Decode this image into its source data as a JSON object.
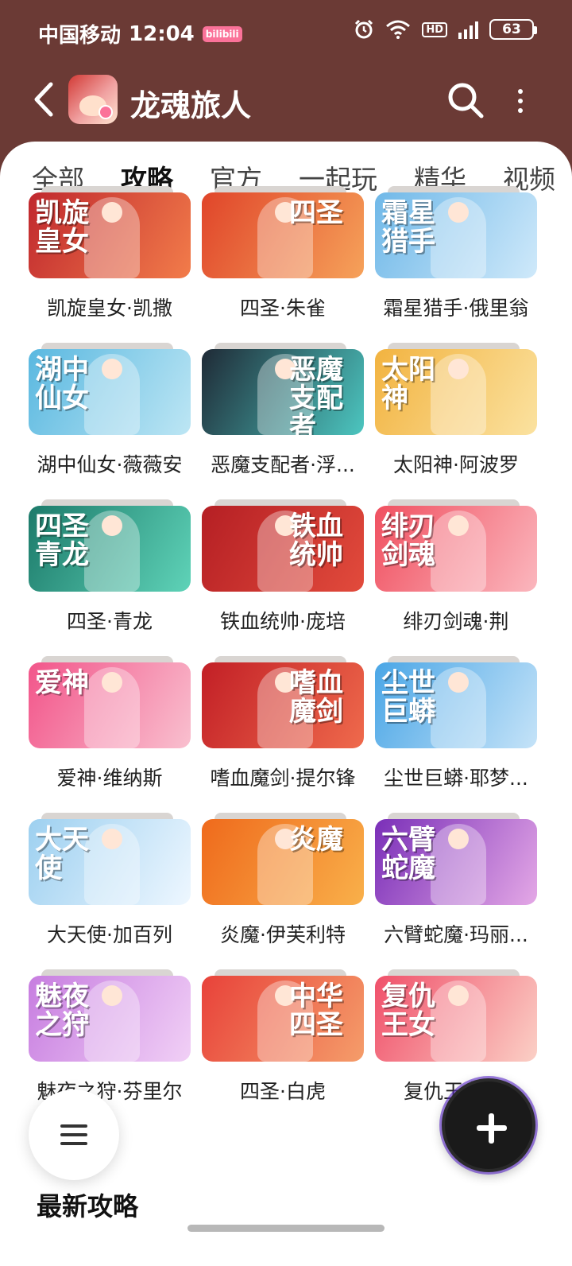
{
  "status_bar": {
    "carrier": "中国移动",
    "time": "12:04",
    "app_badge": "bilibili",
    "hd": "HD",
    "battery": "63"
  },
  "header": {
    "back": "‹",
    "title": "龙魂旅人"
  },
  "tabs": [
    "全部",
    "攻略",
    "官方",
    "一起玩",
    "精华",
    "视频"
  ],
  "active_tab": "攻略",
  "cards": [
    {
      "title": "凯旋皇女·凯撒",
      "art": "凯旋皇女",
      "colors": [
        "#c0282e",
        "#f27c4a"
      ]
    },
    {
      "title": "四圣·朱雀",
      "art": "四圣",
      "colors": [
        "#e0452a",
        "#f6a25a"
      ]
    },
    {
      "title": "霜星猎手·俄里翁",
      "art": "霜星猎手",
      "colors": [
        "#6fb8e8",
        "#cfe9fa"
      ]
    },
    {
      "title": "湖中仙女·薇薇安",
      "art": "湖中仙女",
      "colors": [
        "#5ab8e0",
        "#bde6f4"
      ]
    },
    {
      "title": "恶魔支配者·浮...",
      "art": "恶魔支配者",
      "colors": [
        "#1f2a36",
        "#4cc6c0"
      ]
    },
    {
      "title": "太阳神·阿波罗",
      "art": "太阳神",
      "colors": [
        "#f2b340",
        "#fbe2a0"
      ]
    },
    {
      "title": "四圣·青龙",
      "art": "四圣青龙",
      "colors": [
        "#1c7a6a",
        "#5fd3b8"
      ]
    },
    {
      "title": "铁血统帅·庞培",
      "art": "铁血统帅",
      "colors": [
        "#b51f24",
        "#e24b3c"
      ]
    },
    {
      "title": "绯刃剑魂·荆",
      "art": "绯刃剑魂",
      "colors": [
        "#f05060",
        "#fbb7be"
      ]
    },
    {
      "title": "爱神·维纳斯",
      "art": "爱神",
      "colors": [
        "#f2558a",
        "#f9c0cf"
      ]
    },
    {
      "title": "嗜血魔剑·提尔锋",
      "art": "嗜血魔剑",
      "colors": [
        "#c21f26",
        "#ef6a4c"
      ]
    },
    {
      "title": "尘世巨蟒·耶梦...",
      "art": "尘世巨蟒",
      "colors": [
        "#4aa6e6",
        "#c5e3f8"
      ]
    },
    {
      "title": "大天使·加百列",
      "art": "大天使",
      "colors": [
        "#9dd0f0",
        "#eef7ff"
      ]
    },
    {
      "title": "炎魔·伊芙利特",
      "art": "炎魔",
      "colors": [
        "#ef6a1c",
        "#f9b04a"
      ]
    },
    {
      "title": "六臂蛇魔·玛丽...",
      "art": "六臂蛇魔",
      "colors": [
        "#7a2fb8",
        "#e4a8e6"
      ]
    },
    {
      "title": "魅夜之狩·芬里尔",
      "art": "魅夜之狩",
      "colors": [
        "#c77de0",
        "#f1d0f6"
      ]
    },
    {
      "title": "四圣·白虎",
      "art": "中华四圣",
      "colors": [
        "#e8423a",
        "#f59d6a"
      ]
    },
    {
      "title": "复仇王女·...",
      "art": "复仇王女",
      "colors": [
        "#f0506a",
        "#fbd0c6"
      ]
    }
  ],
  "section_title": "最新攻略"
}
